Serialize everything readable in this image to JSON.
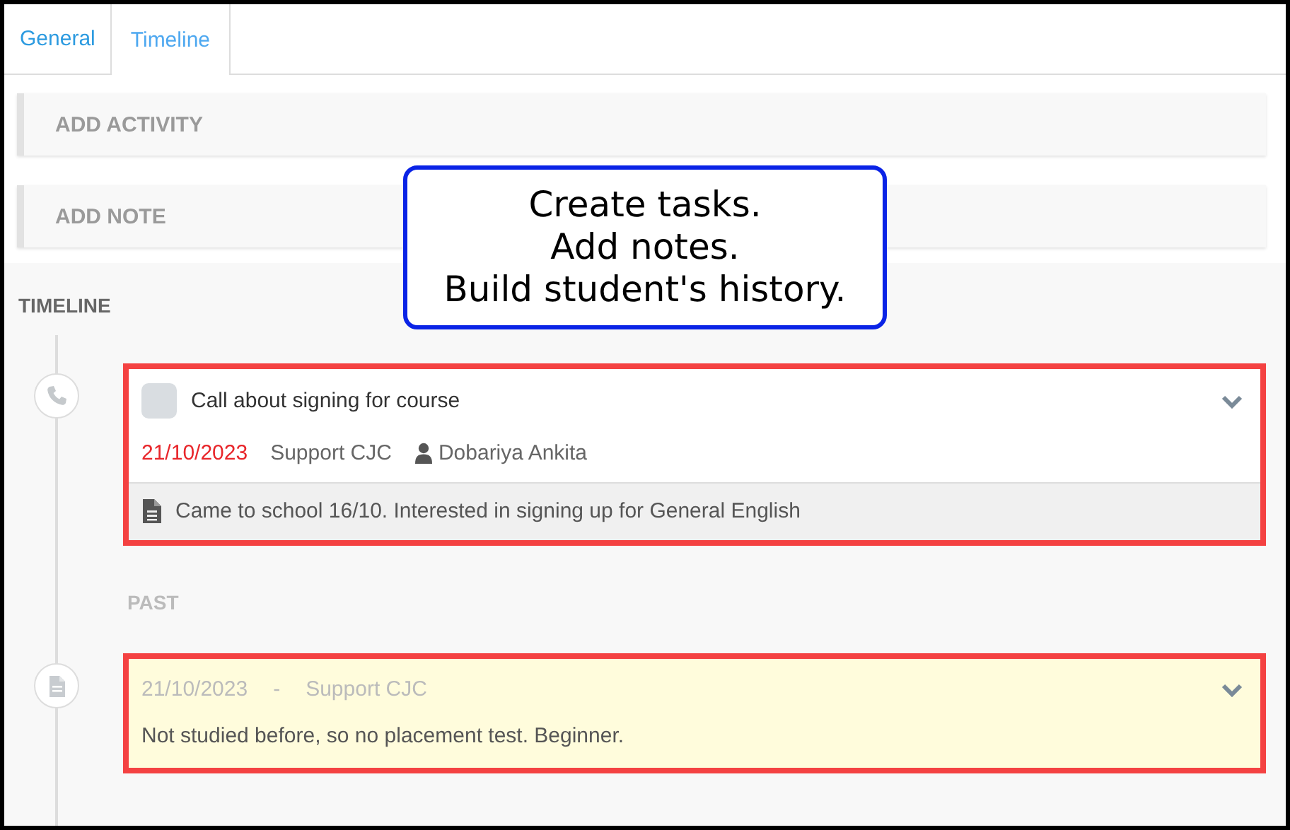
{
  "tabs": [
    {
      "label": "General",
      "selected": false
    },
    {
      "label": "Timeline",
      "selected": true
    }
  ],
  "actions": [
    {
      "label": "ADD ACTIVITY"
    },
    {
      "label": "ADD NOTE"
    }
  ],
  "callout": {
    "text": "Create tasks.\nAdd notes.\nBuild student's history."
  },
  "timeline": {
    "heading": "TIMELINE",
    "entries": [
      {
        "kind": "task",
        "highlighted": true,
        "checked": false,
        "title": "Call about signing for course",
        "date": "21/10/2023",
        "overdue": true,
        "owner": "Support CJC",
        "assignee": "Dobariya Ankita",
        "note": "Came to school 16/10. Interested in signing up for General English"
      },
      {
        "kind": "section",
        "label": "PAST"
      },
      {
        "kind": "note",
        "highlighted": true,
        "date": "21/10/2023",
        "separator": "-",
        "owner": "Support CJC",
        "text": "Not studied before, so no placement test. Beginner."
      }
    ]
  }
}
